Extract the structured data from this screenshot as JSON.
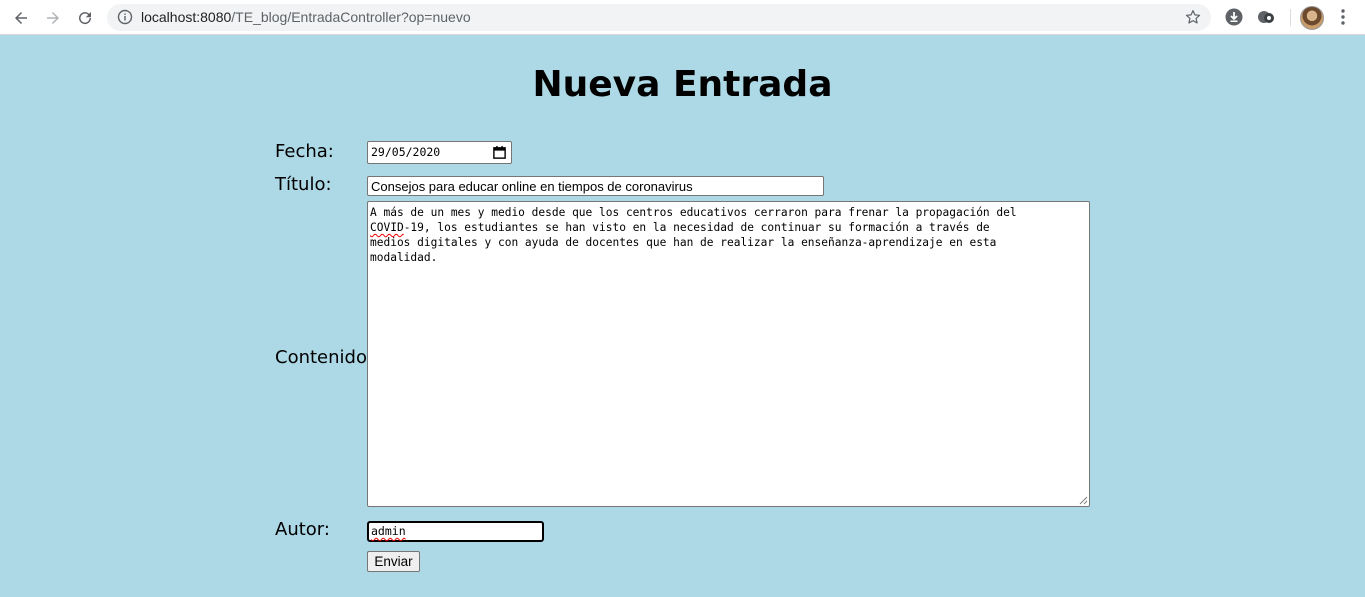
{
  "browser": {
    "url_host": "localhost:8080",
    "url_path": "/TE_blog/EntradaController?op=nuevo",
    "icons": [
      "back-arrow-icon",
      "forward-arrow-icon",
      "reload-icon",
      "info-icon",
      "star-icon",
      "download-icon",
      "extension-icon",
      "profile-avatar",
      "more-menu-icon"
    ]
  },
  "page": {
    "title": "Nueva Entrada",
    "background": "#ADD8E6"
  },
  "form": {
    "fecha_label": "Fecha:",
    "fecha_value": "29/05/2020",
    "titulo_label": "Título:",
    "titulo_value": "Consejos para educar online en tiempos de coronavirus",
    "contenido_label": "Contenido:",
    "contenido_before": "A más de un mes y medio desde que los centros educativos cerraron para frenar la propagación del\n",
    "contenido_covid": "COVID",
    "contenido_after": "-19, los estudiantes se han visto en la necesidad de continuar su formación a través de\nmedios digitales y con ayuda de docentes que han de realizar la enseñanza-aprendizaje en esta\nmodalidad.",
    "autor_label": "Autor:",
    "autor_value": "admin",
    "submit_label": "Enviar"
  }
}
